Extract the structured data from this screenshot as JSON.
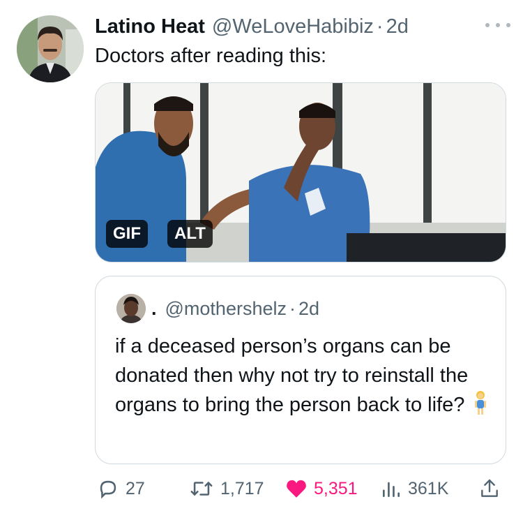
{
  "tweet": {
    "author_name": "Latino Heat",
    "handle": "@WeLoveHabibiz",
    "separator": "·",
    "time": "2d",
    "text": "Doctors after reading this:",
    "media": {
      "badge_gif": "GIF",
      "badge_alt": "ALT"
    }
  },
  "quote": {
    "name": ".",
    "handle": "@mothershelz",
    "separator": "·",
    "time": "2d",
    "text": "if a deceased person’s organs can be donated then why not try to reinstall the organs to bring the person back to life?"
  },
  "actions": {
    "replies": "27",
    "reposts": "1,717",
    "likes": "5,351",
    "views": "361K"
  },
  "colors": {
    "text": "#0f1419",
    "secondary": "#536471",
    "like": "#f91880",
    "border": "#cfd9de"
  },
  "icons": [
    "more-icon",
    "reply-icon",
    "repost-icon",
    "like-icon",
    "views-icon",
    "share-icon"
  ]
}
